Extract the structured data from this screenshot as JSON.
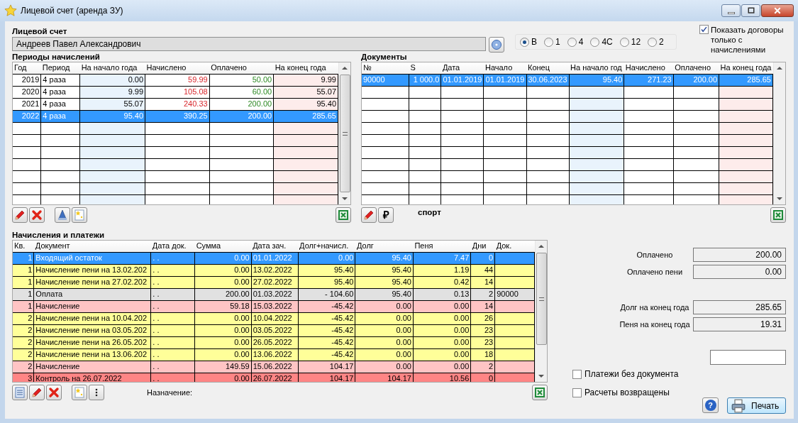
{
  "window": {
    "title": "Лицевой счет (аренда ЗУ)"
  },
  "account": {
    "label": "Лицевой счет",
    "value": "Андреев Павел Александрович"
  },
  "modes": [
    {
      "label": "В",
      "selected": true
    },
    {
      "label": "1",
      "selected": false
    },
    {
      "label": "4",
      "selected": false
    },
    {
      "label": "4С",
      "selected": false
    },
    {
      "label": "12",
      "selected": false
    },
    {
      "label": "2",
      "selected": false
    }
  ],
  "filter": {
    "label": "Показать договоры только с начислениями",
    "checked": true
  },
  "periods": {
    "title": "Периоды начислений",
    "columns": [
      {
        "label": "Год",
        "kind": "amount"
      },
      {
        "label": "Период",
        "kind": "text"
      },
      {
        "label": "На начало года",
        "kind": "opening"
      },
      {
        "label": "Начислено",
        "kind": "charged"
      },
      {
        "label": "Оплачено",
        "kind": "paid"
      },
      {
        "label": "На конец года",
        "kind": "closing"
      }
    ],
    "rows": [
      {
        "selected": false,
        "cells": [
          "2019",
          "4 раза",
          "0.00",
          "59.99",
          "50.00",
          "9.99"
        ]
      },
      {
        "selected": false,
        "cells": [
          "2020",
          "4 раза",
          "9.99",
          "105.08",
          "60.00",
          "55.07"
        ]
      },
      {
        "selected": false,
        "cells": [
          "2021",
          "4 раза",
          "55.07",
          "240.33",
          "200.00",
          "95.40"
        ]
      },
      {
        "selected": true,
        "cells": [
          "2022",
          "4 раза",
          "95.40",
          "390.25",
          "200.00",
          "285.65"
        ]
      }
    ]
  },
  "documents": {
    "title": "Документы",
    "columns": [
      {
        "label": "№",
        "kind": "text"
      },
      {
        "label": "S",
        "kind": "amount"
      },
      {
        "label": "Дата",
        "kind": "text"
      },
      {
        "label": "Начало",
        "kind": "text"
      },
      {
        "label": "Конец",
        "kind": "text"
      },
      {
        "label": "На начало год",
        "kind": "opening"
      },
      {
        "label": "Начислено",
        "kind": "amount"
      },
      {
        "label": "Оплачено",
        "kind": "amount"
      },
      {
        "label": "На конец года",
        "kind": "closing"
      }
    ],
    "rows": [
      {
        "selected": true,
        "cells": [
          "90000",
          "1 000.0",
          "01.01.2019",
          "01.01.2019",
          "30.06.2023",
          "95.40",
          "271.23",
          "200.00",
          "285.65"
        ]
      }
    ],
    "ruble_button": "₽",
    "note": "спорт"
  },
  "transactions": {
    "title": "Начисления и платежи",
    "columns": [
      {
        "label": "Кв.",
        "kind": "amount"
      },
      {
        "label": "Документ",
        "kind": "text"
      },
      {
        "label": "Дата док.",
        "kind": "text"
      },
      {
        "label": "Сумма",
        "kind": "amount"
      },
      {
        "label": "Дата зач.",
        "kind": "text"
      },
      {
        "label": "Долг+начисл.",
        "kind": "amount"
      },
      {
        "label": "Долг",
        "kind": "amount"
      },
      {
        "label": "Пеня",
        "kind": "amount"
      },
      {
        "label": "Дни",
        "kind": "amount"
      },
      {
        "label": "Док.",
        "kind": "text"
      }
    ],
    "rows": [
      {
        "kind": "opening",
        "selected": true,
        "cells": [
          "1",
          "Входящий остаток",
          ". .",
          "0.00",
          "01.01.2022",
          "0.00",
          "95.40",
          "7.47",
          "0"
        ]
      },
      {
        "kind": "penalty",
        "selected": false,
        "cells": [
          "1",
          "Начисление пени на 13.02.202",
          ". .",
          "0.00",
          "13.02.2022",
          "95.40",
          "95.40",
          "1.19",
          "44"
        ]
      },
      {
        "kind": "penalty",
        "selected": false,
        "cells": [
          "1",
          "Начисление пени на 27.02.202",
          ". .",
          "0.00",
          "27.02.2022",
          "95.40",
          "95.40",
          "0.42",
          "14"
        ]
      },
      {
        "kind": "payment",
        "selected": false,
        "cells": [
          "1",
          "Оплата",
          ". .",
          "200.00",
          "01.03.2022",
          "- 104.60",
          "95.40",
          "0.13",
          "2",
          "90000"
        ]
      },
      {
        "kind": "charge",
        "selected": false,
        "cells": [
          "1",
          "Начисление",
          ". .",
          "59.18",
          "15.03.2022",
          "-45.42",
          "0.00",
          "0.00",
          "14"
        ]
      },
      {
        "kind": "penalty",
        "selected": false,
        "cells": [
          "2",
          "Начисление пени на 10.04.202",
          ". .",
          "0.00",
          "10.04.2022",
          "-45.42",
          "0.00",
          "0.00",
          "26"
        ]
      },
      {
        "kind": "penalty",
        "selected": false,
        "cells": [
          "2",
          "Начисление пени на 03.05.202",
          ". .",
          "0.00",
          "03.05.2022",
          "-45.42",
          "0.00",
          "0.00",
          "23"
        ]
      },
      {
        "kind": "penalty",
        "selected": false,
        "cells": [
          "2",
          "Начисление пени на 26.05.202",
          ". .",
          "0.00",
          "26.05.2022",
          "-45.42",
          "0.00",
          "0.00",
          "23"
        ]
      },
      {
        "kind": "penalty",
        "selected": false,
        "cells": [
          "2",
          "Начисление пени на 13.06.202",
          ". .",
          "0.00",
          "13.06.2022",
          "-45.42",
          "0.00",
          "0.00",
          "18"
        ]
      },
      {
        "kind": "charge",
        "selected": false,
        "cells": [
          "2",
          "Начисление",
          ". .",
          "149.59",
          "15.06.2022",
          "104.17",
          "0.00",
          "0.00",
          "2"
        ]
      },
      {
        "kind": "control",
        "selected": false,
        "cells": [
          "3",
          "Контроль на 26.07.2022",
          ". .",
          "0.00",
          "26.07.2022",
          "104.17",
          "104.17",
          "10.56",
          "0"
        ]
      }
    ],
    "purpose_label": "Назначение:"
  },
  "totals": [
    {
      "label": "Оплачено",
      "value": "200.00"
    },
    {
      "label": "Оплачено пени",
      "value": "0.00"
    },
    {
      "label": "Долг на конец года",
      "value": "285.65"
    },
    {
      "label": "Пеня на конец года",
      "value": "19.31"
    }
  ],
  "options": [
    {
      "label": "Платежи без документа",
      "checked": false
    },
    {
      "label": "Расчеты возвращены",
      "checked": false
    }
  ],
  "help_button": "?",
  "print_button": "Печать"
}
